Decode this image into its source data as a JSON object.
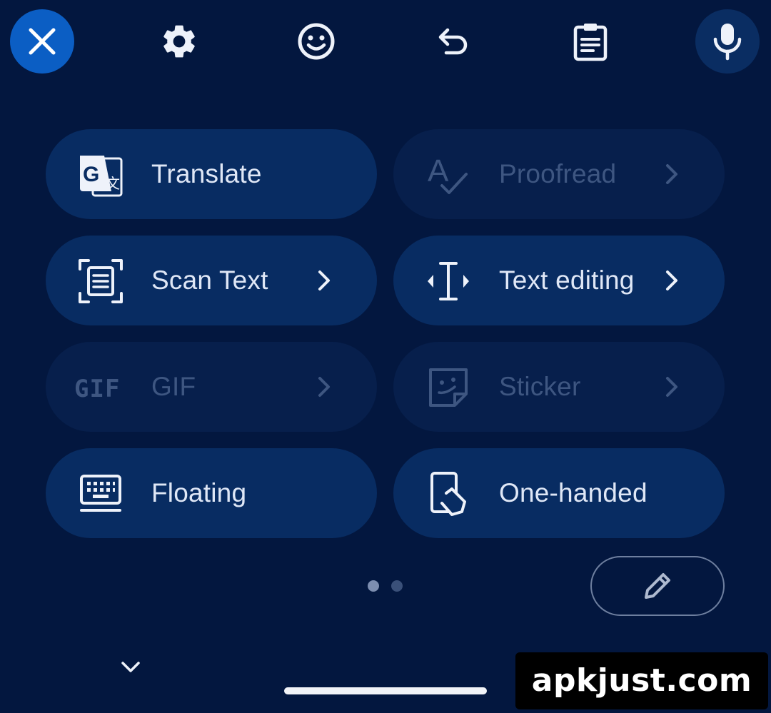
{
  "toolbar": {
    "items": [
      {
        "icon": "close-icon"
      },
      {
        "icon": "gear-icon"
      },
      {
        "icon": "emoji-icon"
      },
      {
        "icon": "undo-icon"
      },
      {
        "icon": "clipboard-icon"
      },
      {
        "icon": "mic-icon"
      }
    ]
  },
  "tiles": [
    {
      "label": "Translate",
      "icon": "translate-icon",
      "enabled": true,
      "chevron": false
    },
    {
      "label": "Proofread",
      "icon": "proofread-icon",
      "enabled": false,
      "chevron": true
    },
    {
      "label": "Scan Text",
      "icon": "scan-text-icon",
      "enabled": true,
      "chevron": true
    },
    {
      "label": "Text editing",
      "icon": "text-cursor-icon",
      "enabled": true,
      "chevron": true
    },
    {
      "label": "GIF",
      "icon": "gif-icon",
      "enabled": false,
      "chevron": true
    },
    {
      "label": "Sticker",
      "icon": "sticker-icon",
      "enabled": false,
      "chevron": true
    },
    {
      "label": "Floating",
      "icon": "keyboard-icon",
      "enabled": true,
      "chevron": false
    },
    {
      "label": "One-handed",
      "icon": "one-handed-icon",
      "enabled": true,
      "chevron": false
    }
  ],
  "pager": {
    "current_page": 1,
    "total_pages": 2
  },
  "watermark": {
    "text": "apkjust.com"
  },
  "colors": {
    "background": "#03173f",
    "tile": "#082c62",
    "tile_disabled": "#071f4c",
    "accent": "#0b5ec4",
    "text": "#dfe7f6",
    "text_disabled": "#3e5681"
  }
}
